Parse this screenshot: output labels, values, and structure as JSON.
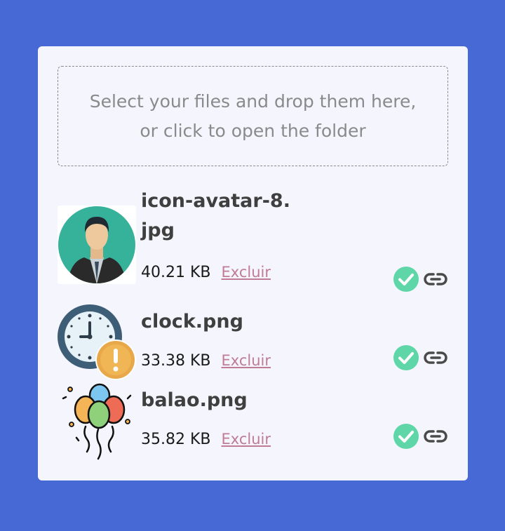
{
  "dropzone": {
    "text": "Select your files and drop them here, or click to open the folder"
  },
  "files": [
    {
      "name": "icon-avatar-8.jpg",
      "size": "40.21 KB",
      "remove_label": "Excluir",
      "thumbnail": "avatar-man-suit",
      "status": "success"
    },
    {
      "name": "clock.png",
      "size": "33.38 KB",
      "remove_label": "Excluir",
      "thumbnail": "clock-with-warning",
      "status": "success"
    },
    {
      "name": "balao.png",
      "size": "35.82 KB",
      "remove_label": "Excluir",
      "thumbnail": "balloons",
      "status": "success"
    }
  ],
  "colors": {
    "background": "#4669d6",
    "card": "#f5f5fe",
    "success": "#5fd6a8",
    "link_icon": "#4a4a4a",
    "remove_link": "#c07b95"
  },
  "icons": {
    "status": "check-circle-icon",
    "link": "link-icon"
  }
}
